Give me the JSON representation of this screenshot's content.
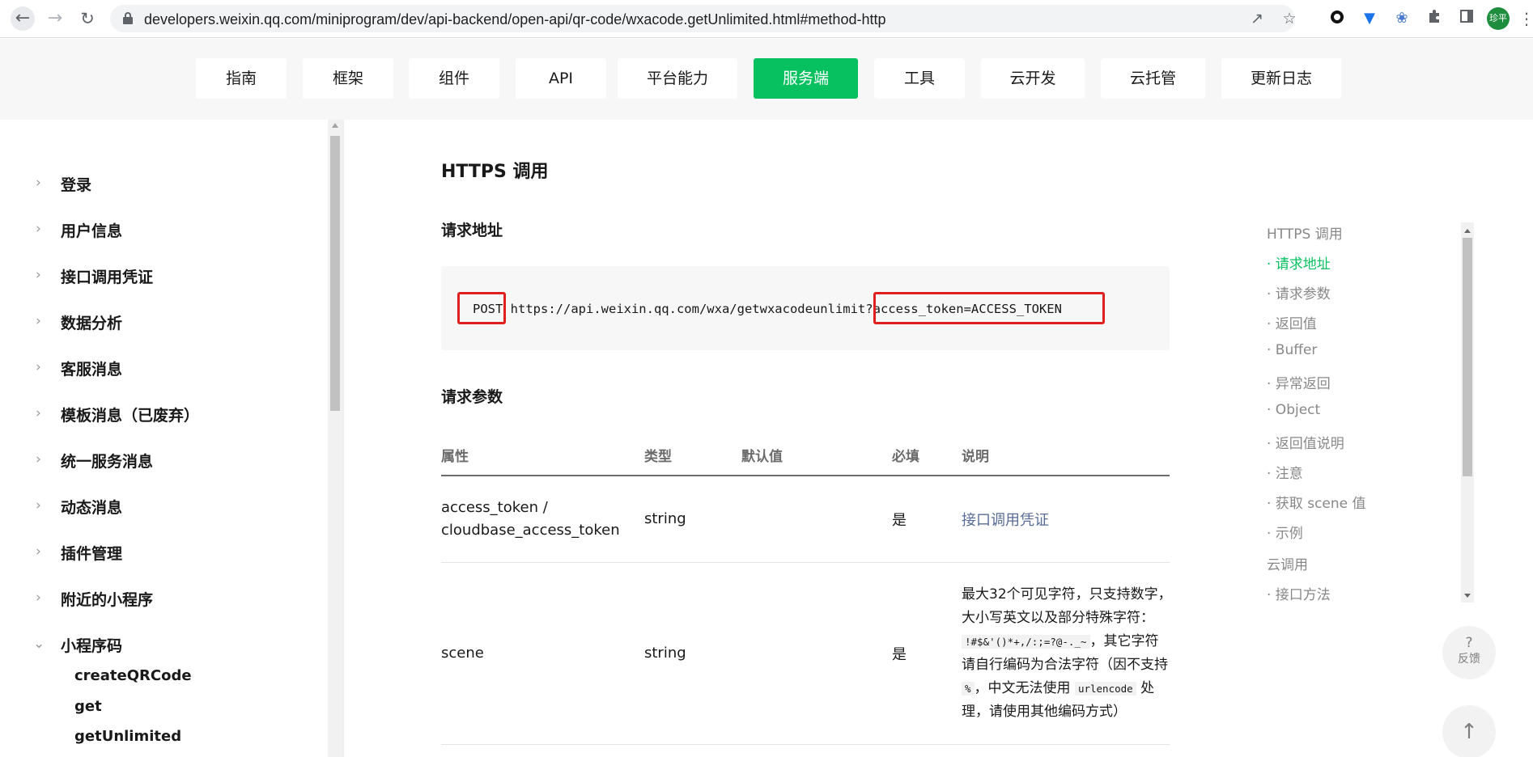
{
  "browser": {
    "url": "developers.weixin.qq.com/miniprogram/dev/api-backend/open-api/qr-code/wxacode.getUnlimited.html#method-http",
    "profile_initials": "珍平"
  },
  "topnav": {
    "tabs": [
      "指南",
      "框架",
      "组件",
      "API",
      "平台能力",
      "服务端",
      "工具",
      "云开发",
      "云托管",
      "更新日志"
    ],
    "active": "服务端"
  },
  "sidebar": {
    "items": [
      "登录",
      "用户信息",
      "接口调用凭证",
      "数据分析",
      "客服消息",
      "模板消息（已废弃）",
      "统一服务消息",
      "动态消息",
      "插件管理",
      "附近的小程序",
      "小程序码"
    ],
    "sub_items": [
      "createQRCode",
      "get",
      "getUnlimited"
    ]
  },
  "main": {
    "title": "HTTPS 调用",
    "request_url_heading": "请求地址",
    "method": "POST",
    "endpoint": "https://api.weixin.qq.com/wxa/getwxacodeunlimit",
    "query": "?access_token=ACCESS_TOKEN",
    "params_heading": "请求参数",
    "table": {
      "headers": [
        "属性",
        "类型",
        "默认值",
        "必填",
        "说明"
      ],
      "rows": [
        {
          "name_line1": "access_token /",
          "name_line2": "cloudbase_access_token",
          "type": "string",
          "default": "",
          "required": "是",
          "desc": "接口调用凭证"
        },
        {
          "name": "scene",
          "type": "string",
          "default": "",
          "required": "是",
          "desc_lines": [
            "最大32个可见字符，只支持数字，",
            "大小写英文以及部分特殊字符：",
            "!#$&'()*+,/:;=?@-._~",
            "，其它字符",
            "请自行编码为合法字符（因不支持",
            "%",
            "，中文无法使用",
            "urlencode",
            "处",
            "理，请使用其他编码方式）"
          ]
        }
      ]
    }
  },
  "toc": {
    "items": [
      "HTTPS 调用",
      "· 请求地址",
      "· 请求参数",
      "· 返回值",
      "· Buffer",
      "· 异常返回",
      "· Object",
      "· 返回值说明",
      "· 注意",
      "· 获取 scene 值",
      "· 示例",
      "云调用",
      "· 接口方法"
    ],
    "active": "· 请求地址"
  },
  "floating": {
    "feedback_icon": "?",
    "feedback_label": "反馈",
    "to_top_icon": "arrow-up-icon"
  },
  "colors": {
    "accent": "#07c160",
    "link": "#576b95",
    "highlight": "#e02020"
  }
}
